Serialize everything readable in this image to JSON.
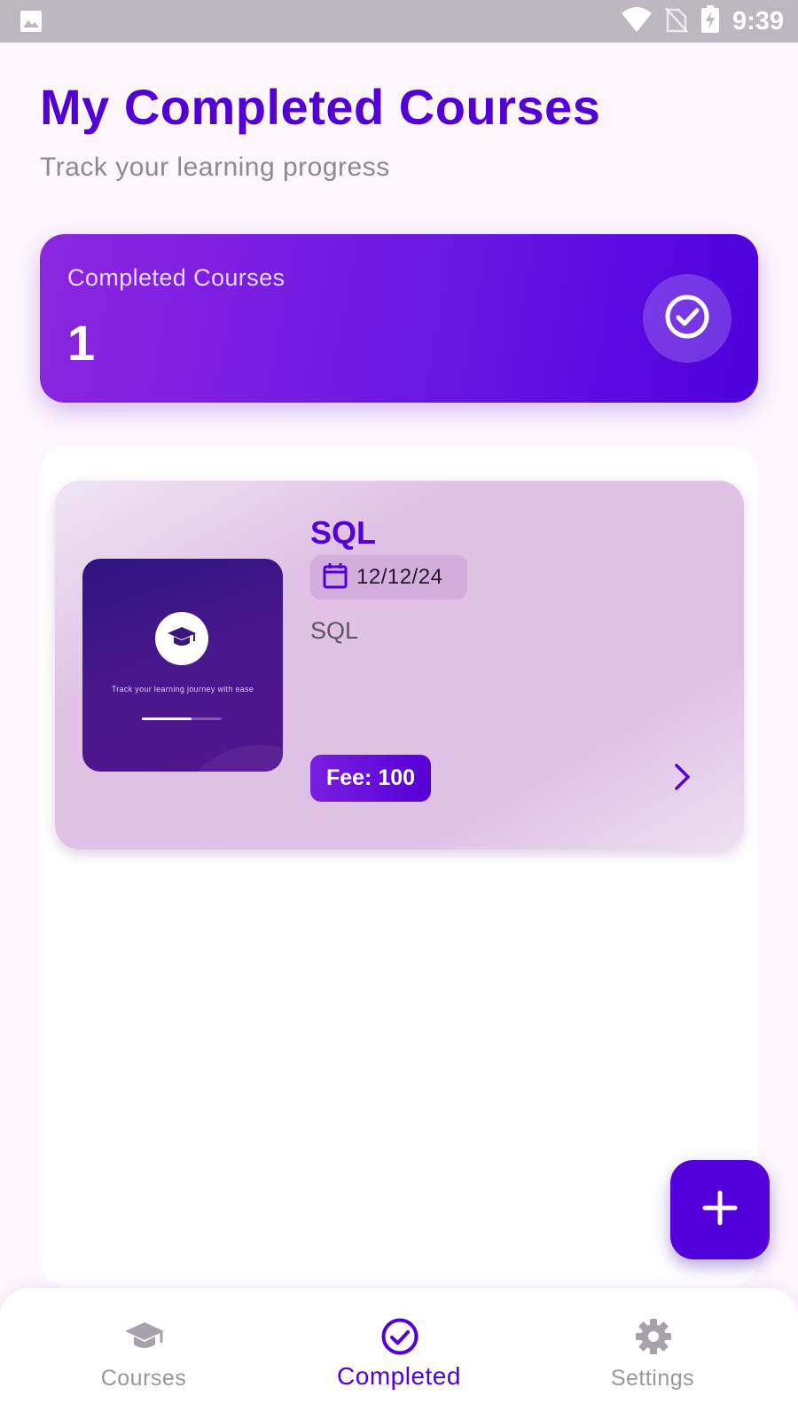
{
  "status_bar": {
    "time": "9:39",
    "icons": [
      "image-icon",
      "wifi-icon",
      "no-sim-icon",
      "battery-charging-icon"
    ]
  },
  "header": {
    "title": "My Completed Courses",
    "subtitle": "Track your learning progress"
  },
  "stats": {
    "label": "Completed Courses",
    "value": "1",
    "icon": "check-circle-icon"
  },
  "courses": [
    {
      "title": "SQL",
      "date": "12/12/24",
      "description": "SQL",
      "fee": "Fee: 100",
      "thumbnail": {
        "icon": "graduation-cap-icon",
        "tagline": "Track your learning journey with ease",
        "progress": 0.62
      }
    }
  ],
  "fab": {
    "icon": "plus-icon"
  },
  "bottom_nav": {
    "items": [
      {
        "label": "Courses",
        "icon": "graduation-cap-icon",
        "active": false
      },
      {
        "label": "Completed",
        "icon": "check-circle-icon",
        "active": true
      },
      {
        "label": "Settings",
        "icon": "gear-icon",
        "active": false
      }
    ]
  },
  "colors": {
    "primary": "#5200d6",
    "background": "#fdf6fd",
    "card": "#e1c2e6",
    "inactive": "#9b959f"
  }
}
